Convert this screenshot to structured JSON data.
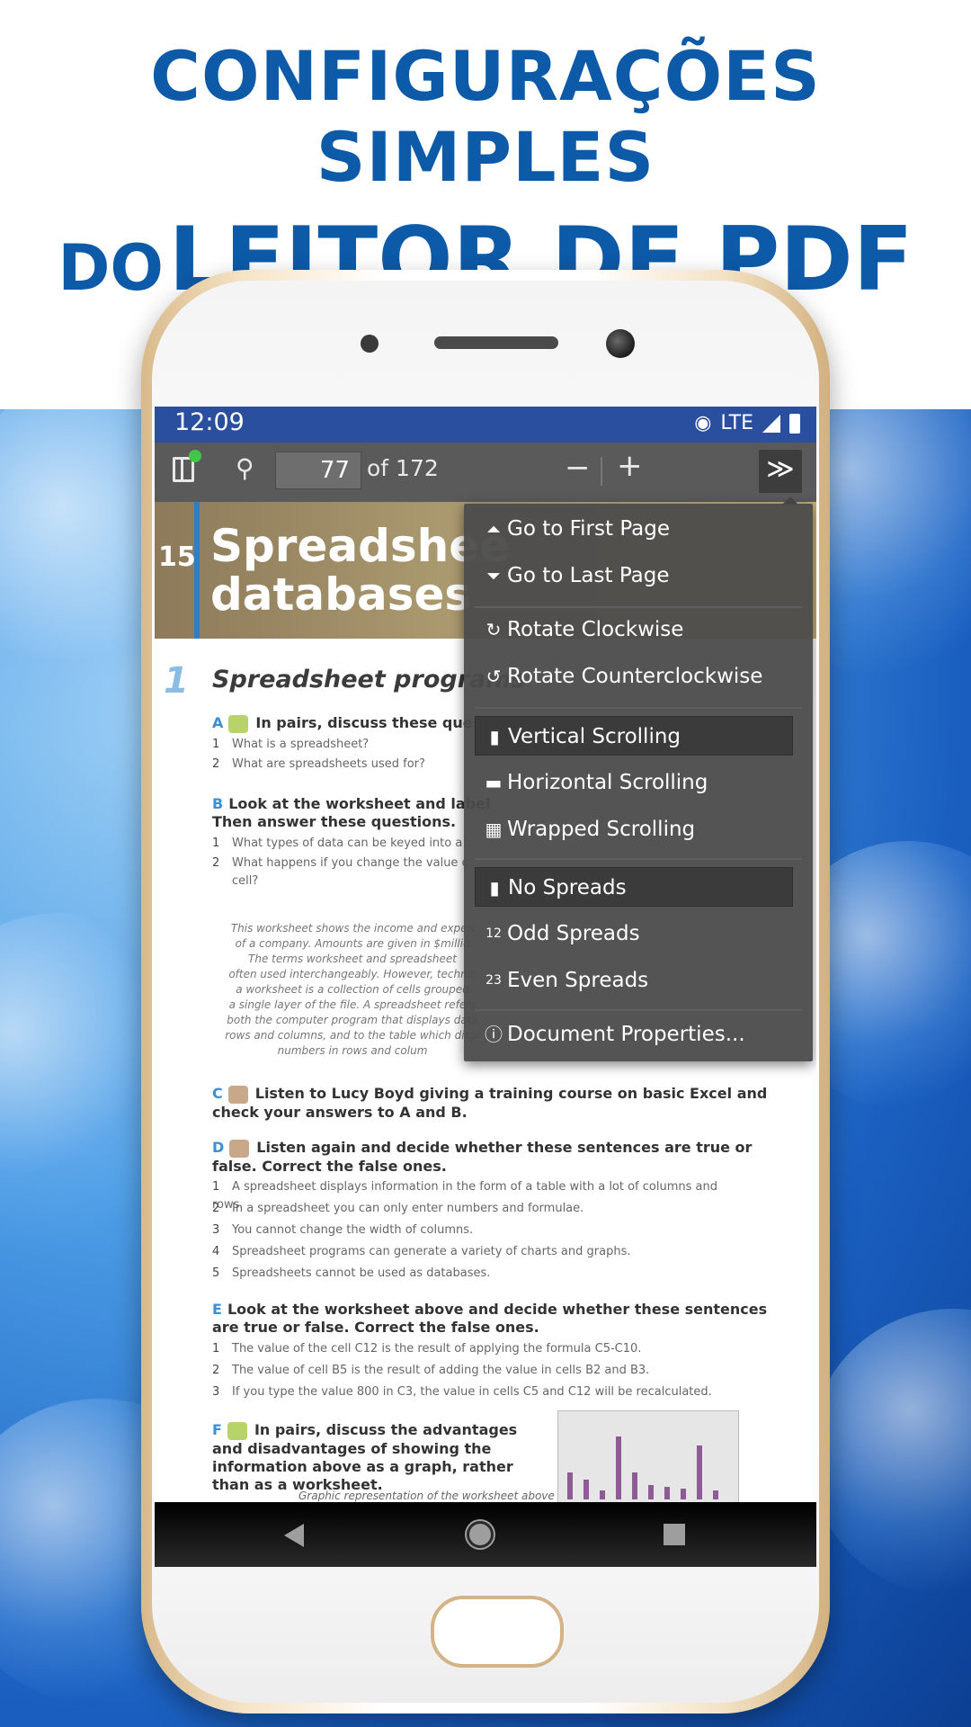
{
  "headline": {
    "line1": "CONFIGURAÇÕES SIMPLES",
    "line2_small": "DO",
    "line2_big": "LEITOR DE PDF"
  },
  "status_bar": {
    "time": "12:09",
    "network": "LTE"
  },
  "toolbar": {
    "page_number": "77",
    "page_count": "of 172",
    "zoom_out_label": "−",
    "zoom_in_label": "+",
    "more_label": "≫"
  },
  "menu": {
    "items": [
      {
        "label": "Go to First Page",
        "glyph": "⏶"
      },
      {
        "label": "Go to Last Page",
        "glyph": "⏷"
      },
      {
        "label": "Rotate Clockwise",
        "glyph": "↻"
      },
      {
        "label": "Rotate Counterclockwise",
        "glyph": "↺"
      },
      {
        "label": "Vertical Scrolling",
        "glyph": "▮"
      },
      {
        "label": "Horizontal Scrolling",
        "glyph": "▬"
      },
      {
        "label": "Wrapped Scrolling",
        "glyph": "▦"
      },
      {
        "label": "No Spreads",
        "glyph": "▮"
      },
      {
        "label": "Odd Spreads",
        "glyph": "12"
      },
      {
        "label": "Even Spreads",
        "glyph": "23"
      },
      {
        "label": "Document Properties...",
        "glyph": "ⓘ"
      }
    ],
    "selected": [
      "Vertical Scrolling",
      "No Spreads"
    ]
  },
  "pdf": {
    "chapter_number": "15",
    "chapter_title_1": "Spreadshee",
    "chapter_title_2": "databases",
    "section_number": "1",
    "section_title": "Spreadsheet programs",
    "task_a": {
      "letter": "A",
      "text": "In pairs, discuss these questi"
    },
    "task_a_q1": "What is a spreadsheet?",
    "task_a_q2": "What are spreadsheets used for?",
    "task_b": {
      "letter": "B",
      "text": "Look at the worksheet and label",
      "text2": "Then answer these questions."
    },
    "task_b_q1": "What types of data can be keyed into a",
    "task_b_q2": "What happens if you change the value c",
    "task_b_q2b": "cell?",
    "paragraph": [
      "This worksheet shows the income and expen",
      "of a company. Amounts are given in $millio",
      "The terms worksheet and spreadsheet",
      "often used interchangeably. However, technic",
      "a worksheet is a collection of cells grouped",
      "a single layer of the file. A spreadsheet refers",
      "both the computer program that displays data",
      "rows and columns, and to the table which displ",
      "numbers in rows and colum"
    ],
    "task_c": {
      "letter": "C",
      "text": "Listen to Lucy Boyd giving a training course on basic Excel and check your answers to A and B."
    },
    "task_d": {
      "letter": "D",
      "text": "Listen again and decide whether these sentences are true or false. Correct the false ones."
    },
    "task_d_items": [
      "A spreadsheet displays information in the form of a table with a lot of columns and rows.",
      "In a spreadsheet you can only enter numbers and formulae.",
      "You cannot change the width of columns.",
      "Spreadsheet programs can generate a variety of charts and graphs.",
      "Spreadsheets cannot be used as databases."
    ],
    "task_e": {
      "letter": "E",
      "text": "Look at the worksheet above and decide whether these sentences are true or false. Correct the false ones."
    },
    "task_e_items": [
      "The value of the cell C12 is the result of applying the formula C5-C10.",
      "The value of cell B5 is the result of adding the value in cells B2 and B3.",
      "If you type the value 800 in C3, the value in cells C5 and C12 will be recalculated."
    ],
    "task_f": {
      "letter": "F",
      "text": "In pairs, discuss the advantages and disadvantages of showing the information above as a graph, rather than as a worksheet."
    },
    "caption": "Graphic representation of the worksheet above"
  },
  "colors": {
    "headline": "#0d5aa8",
    "status_bar": "#2a4f9e",
    "toolbar": "#5a5a5a",
    "menu": "#4b4b4b"
  }
}
